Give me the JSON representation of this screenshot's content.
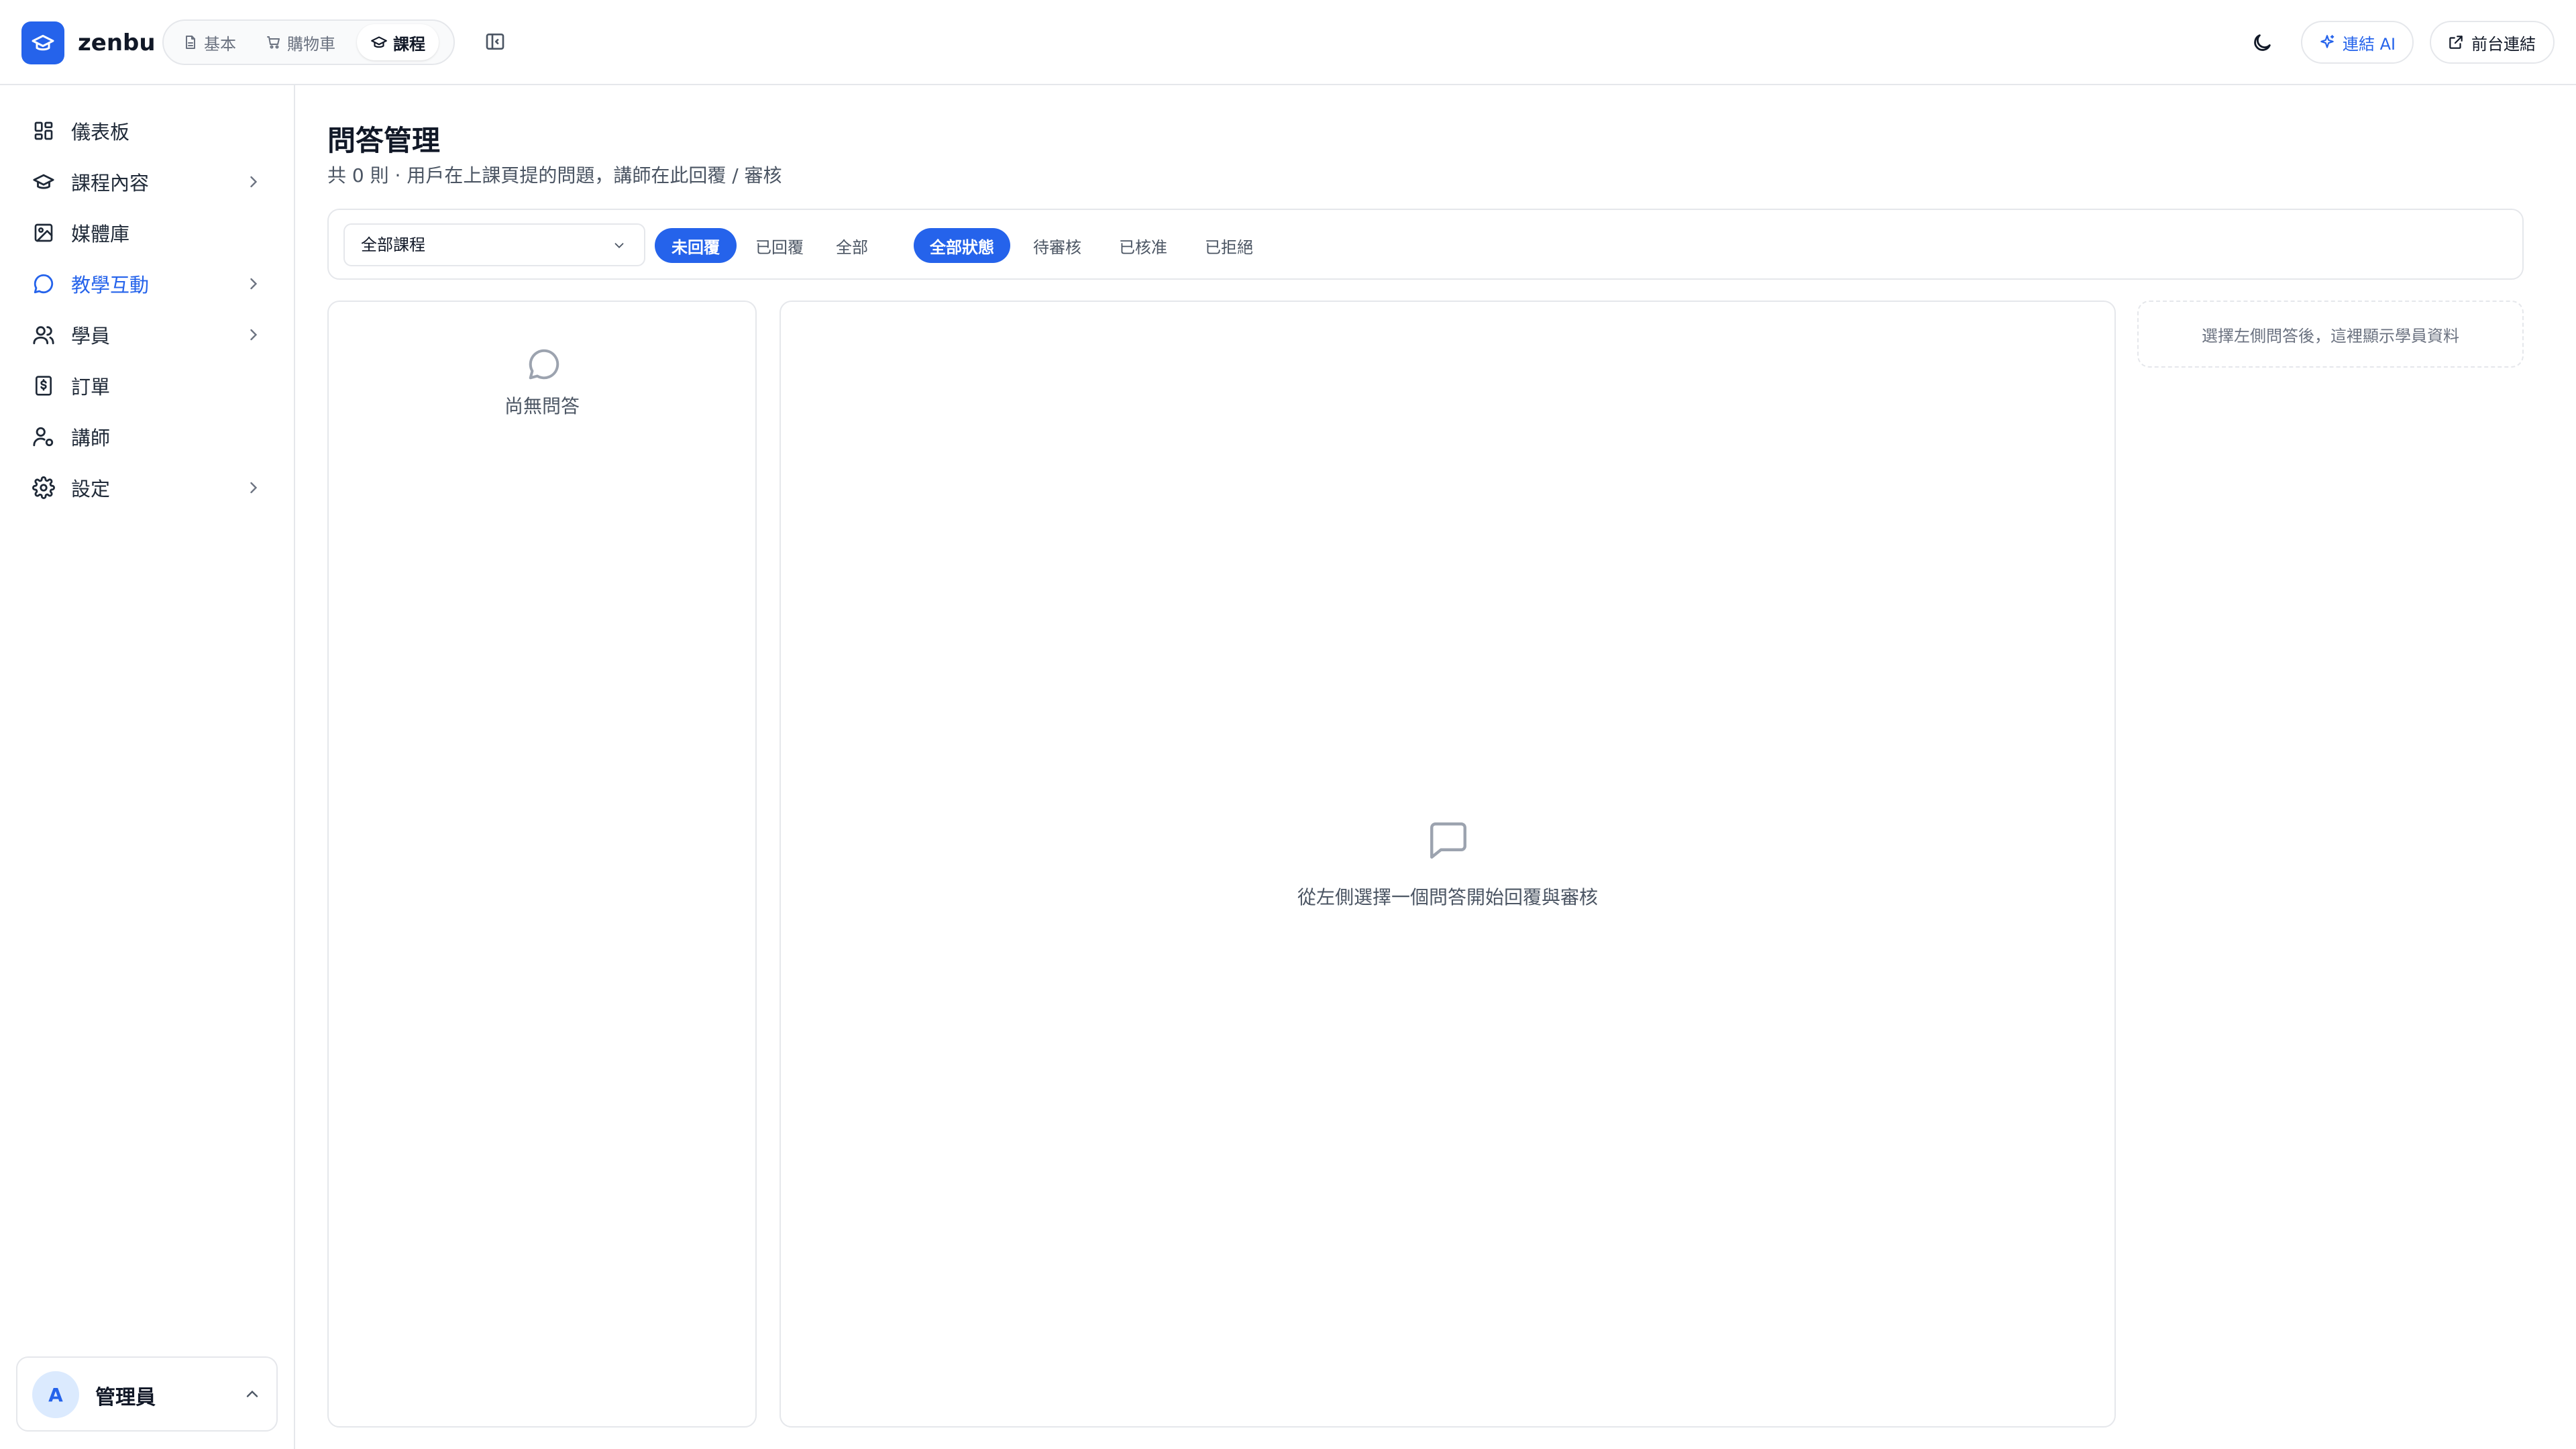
{
  "app": {
    "name": "zenbu",
    "brand_color": "#2563eb",
    "logo_icon": "graduation-cap-icon"
  },
  "topbar": {
    "modes": [
      {
        "label": "基本",
        "icon": "file-icon"
      },
      {
        "label": "購物車",
        "icon": "cart-icon"
      },
      {
        "label": "課程",
        "icon": "graduation-cap-icon",
        "active": true
      }
    ],
    "collapse_icon": "sidebar-toggle-icon",
    "theme_icon": "moon-icon",
    "ai_button": {
      "label": "連結 AI",
      "icon": "sparkle-icon"
    },
    "front_button": {
      "label": "前台連結",
      "icon": "external-link-icon"
    }
  },
  "sidebar": {
    "items": [
      {
        "label": "儀表板",
        "icon": "dashboard-grid-icon"
      },
      {
        "label": "課程內容",
        "icon": "graduation-cap-icon",
        "has_children": true
      },
      {
        "label": "媒體庫",
        "icon": "image-icon"
      },
      {
        "label": "教學互動",
        "icon": "chat-bubble-icon",
        "has_children": true,
        "active": true
      },
      {
        "label": "學員",
        "icon": "users-icon",
        "has_children": true
      },
      {
        "label": "訂單",
        "icon": "receipt-dollar-icon"
      },
      {
        "label": "講師",
        "icon": "user-gear-icon"
      },
      {
        "label": "設定",
        "icon": "gear-icon",
        "has_children": true
      }
    ],
    "user": {
      "initial": "A",
      "name": "管理員"
    }
  },
  "main": {
    "title": "問答管理",
    "subtitle": "共 0 則 · 用戶在上課頁提的問題，講師在此回覆 / 審核",
    "course_select": {
      "value": "全部課程"
    },
    "reply_filters": [
      {
        "label": "未回覆",
        "active": true
      },
      {
        "label": "已回覆"
      },
      {
        "label": "全部"
      }
    ],
    "status_filters": [
      {
        "label": "全部狀態",
        "active": true
      },
      {
        "label": "待審核"
      },
      {
        "label": "已核准"
      },
      {
        "label": "已拒絕"
      }
    ],
    "list_empty": "尚無問答",
    "detail_empty": "從左側選擇一個問答開始回覆與審核",
    "student_hint": "選擇左側問答後，這裡顯示學員資料"
  }
}
